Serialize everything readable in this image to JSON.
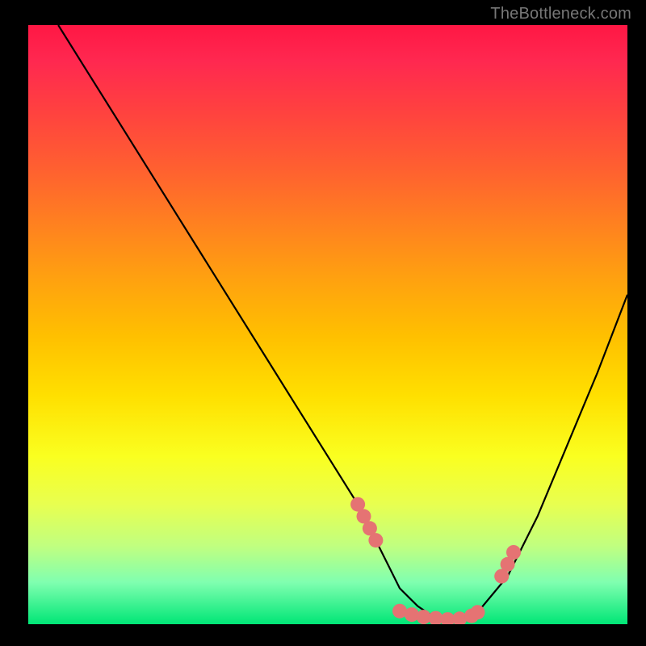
{
  "watermark": "TheBottleneck.com",
  "chart_data": {
    "type": "line",
    "title": "",
    "xlabel": "",
    "ylabel": "",
    "xlim": [
      0,
      100
    ],
    "ylim": [
      0,
      100
    ],
    "curve": {
      "x": [
        5,
        10,
        15,
        20,
        25,
        30,
        35,
        40,
        45,
        50,
        55,
        58,
        60,
        62,
        65,
        68,
        70,
        72,
        75,
        80,
        85,
        90,
        95,
        100
      ],
      "y": [
        100,
        92,
        84,
        76,
        68,
        60,
        52,
        44,
        36,
        28,
        20,
        14,
        10,
        6,
        3,
        1,
        0.5,
        0.7,
        2,
        8,
        18,
        30,
        42,
        55
      ]
    },
    "markers": {
      "x": [
        55,
        56,
        57,
        58,
        62,
        64,
        66,
        68,
        70,
        72,
        74,
        75,
        79,
        80,
        81
      ],
      "y": [
        20,
        18,
        16,
        14,
        2.2,
        1.6,
        1.2,
        1.0,
        0.8,
        0.9,
        1.4,
        2.0,
        8,
        10,
        12
      ],
      "color": "#e57373",
      "size": 9
    }
  }
}
